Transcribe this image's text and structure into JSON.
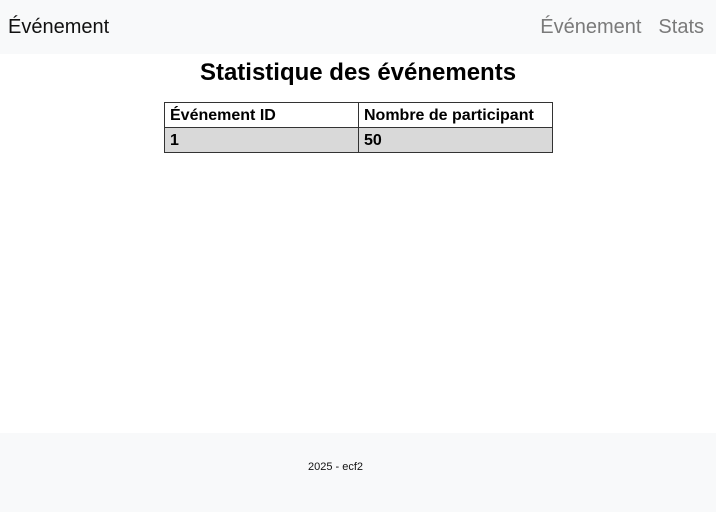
{
  "navbar": {
    "brand": "Événement",
    "links": [
      "Événement",
      "Stats"
    ]
  },
  "main": {
    "title": "Statistique des événements",
    "table": {
      "headers": [
        "Événement ID",
        "Nombre de participant"
      ],
      "rows": [
        [
          "1",
          "50"
        ]
      ]
    }
  },
  "footer": {
    "text": "2025 - ecf2"
  },
  "colors": {
    "navbar_bg": "#f8f9fa",
    "nav_link": "#7a7a7a",
    "row_bg": "#d9d9d9",
    "border": "#333333"
  }
}
